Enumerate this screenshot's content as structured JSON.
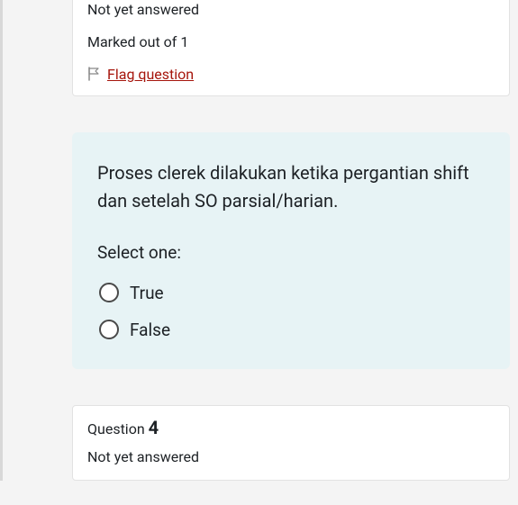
{
  "q3_info": {
    "status": "Not yet answered",
    "marked": "Marked out of 1",
    "flag_label": "Flag question"
  },
  "q3_content": {
    "text": "Proses clerek dilakukan ketika pergantian shift dan setelah SO parsial/harian.",
    "prompt": "Select one:",
    "option_true": "True",
    "option_false": "False"
  },
  "q4_info": {
    "number_label": "Question ",
    "number_value": "4",
    "status": "Not yet answered"
  }
}
